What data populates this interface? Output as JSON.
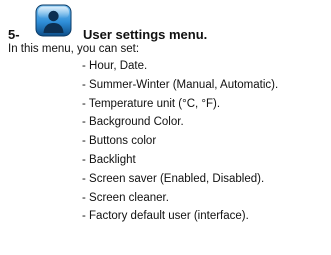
{
  "section": {
    "number": "5-",
    "title": "User settings menu.",
    "icon": "user-icon"
  },
  "intro": "In this menu, you can set:",
  "options": [
    "- Hour, Date.",
    "- Summer-Winter (Manual, Automatic).",
    "- Temperature unit (°C, °F).",
    "- Background Color.",
    "- Buttons color",
    "- Backlight",
    "- Screen saver (Enabled, Disabled).",
    "- Screen cleaner.",
    "- Factory default user (interface)."
  ],
  "colors": {
    "icon_blue": "#2f8ed8",
    "icon_dark": "#0d4f8a",
    "text": "#111111"
  }
}
